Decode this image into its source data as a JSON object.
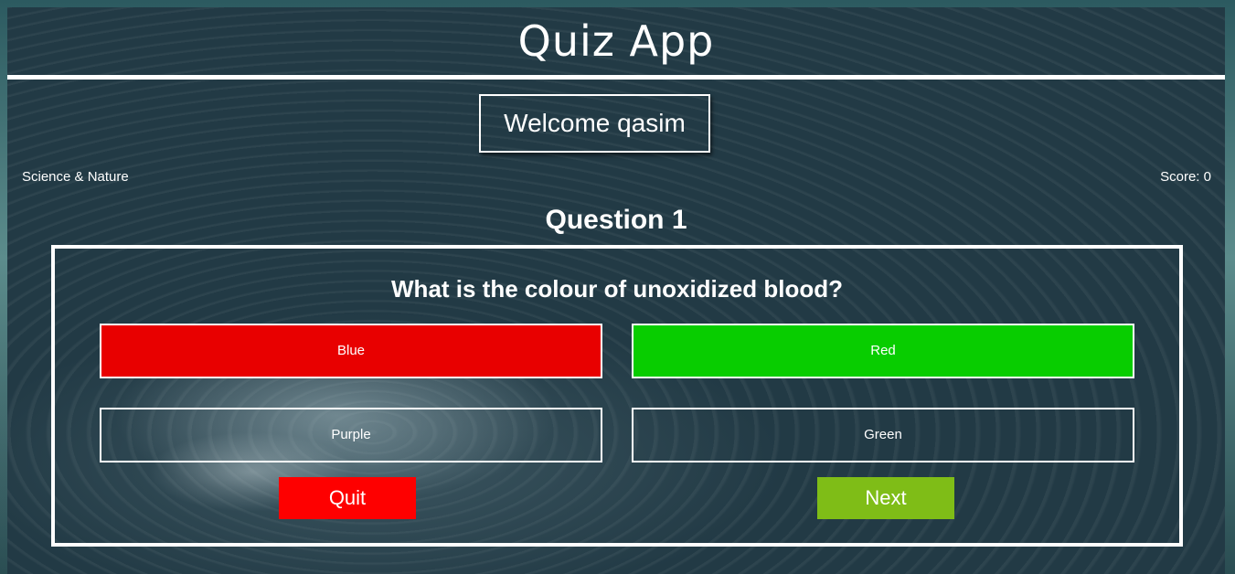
{
  "header": {
    "title": "Quiz App"
  },
  "welcome": {
    "text": "Welcome qasim"
  },
  "category": "Science & Nature",
  "score_text": "Score: 0",
  "question_number": "Question 1",
  "question": {
    "text": "What is the colour of unoxidized blood?",
    "options": [
      {
        "label": "Blue",
        "state": "incorrect",
        "color": "#e80000"
      },
      {
        "label": "Red",
        "state": "correct",
        "color": "#08cd00"
      },
      {
        "label": "Purple",
        "state": "neutral",
        "color": "transparent"
      },
      {
        "label": "Green",
        "state": "neutral",
        "color": "transparent"
      }
    ]
  },
  "buttons": {
    "quit": {
      "label": "Quit",
      "color": "#fe0000"
    },
    "next": {
      "label": "Next",
      "color": "#7fbd17"
    }
  }
}
